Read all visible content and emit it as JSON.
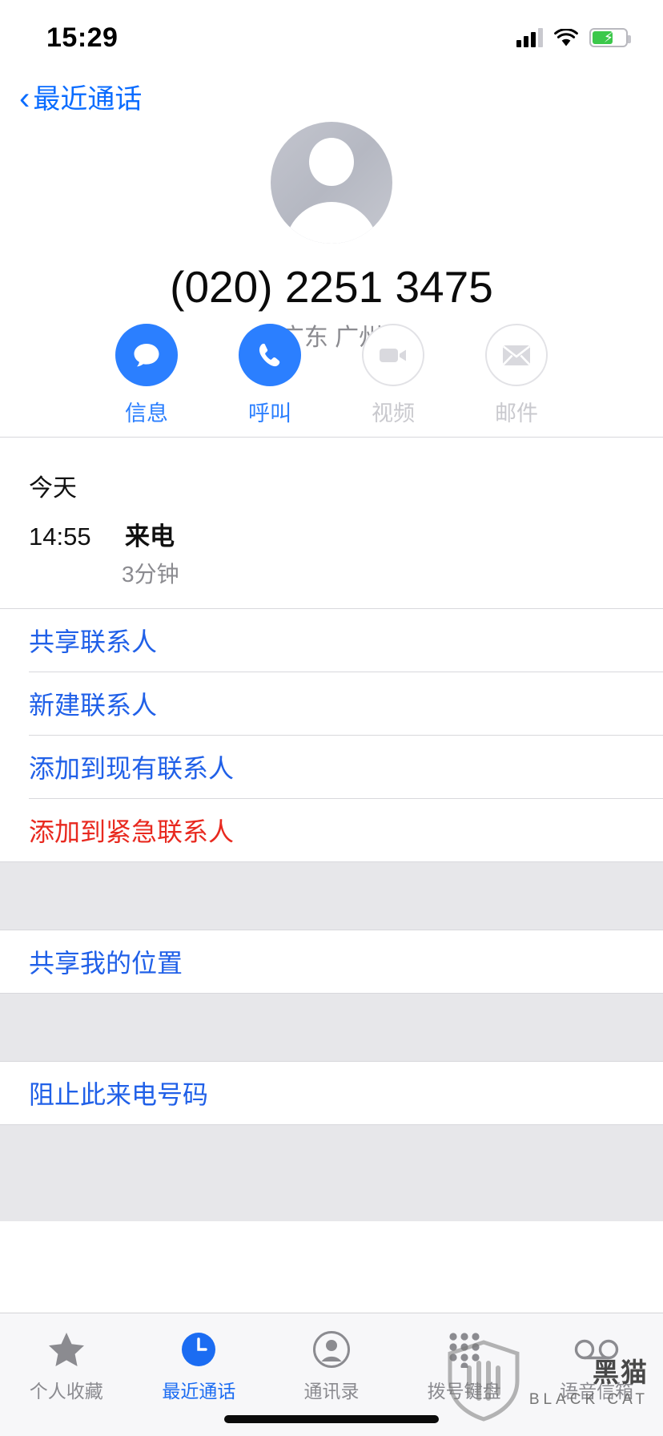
{
  "status_bar": {
    "time": "15:29",
    "signal_icon": "cellular-signal-icon",
    "wifi_icon": "wifi-icon",
    "battery_icon": "battery-charging-icon"
  },
  "nav": {
    "back_label": "最近通话",
    "back_icon": "chevron-left-icon",
    "accent": "#0a6cff"
  },
  "contact": {
    "avatar_icon": "person-placeholder-avatar",
    "phone_number": "(020) 2251 3475",
    "location": "广东 广州"
  },
  "actions": [
    {
      "label": "信息",
      "icon": "message-bubble-icon",
      "enabled": true
    },
    {
      "label": "呼叫",
      "icon": "phone-handset-icon",
      "enabled": true
    },
    {
      "label": "视频",
      "icon": "video-camera-icon",
      "enabled": false
    },
    {
      "label": "邮件",
      "icon": "envelope-icon",
      "enabled": false
    }
  ],
  "call_log": {
    "day_header": "今天",
    "time": "14:55",
    "type": "来电",
    "duration": "3分钟"
  },
  "list": {
    "group1": [
      {
        "label": "共享联系人",
        "style": "blue"
      },
      {
        "label": "新建联系人",
        "style": "blue"
      },
      {
        "label": "添加到现有联系人",
        "style": "blue"
      },
      {
        "label": "添加到紧急联系人",
        "style": "red"
      }
    ],
    "group2": [
      {
        "label": "共享我的位置",
        "style": "blue"
      }
    ],
    "group3": [
      {
        "label": "阻止此来电号码",
        "style": "blue"
      }
    ]
  },
  "tabs": [
    {
      "label": "个人收藏",
      "icon": "star-icon",
      "active": false
    },
    {
      "label": "最近通话",
      "icon": "recents-clock-icon",
      "active": true
    },
    {
      "label": "通讯录",
      "icon": "contacts-person-icon",
      "active": false
    },
    {
      "label": "拨号键盘",
      "icon": "keypad-dots-icon",
      "active": false
    },
    {
      "label": "语音信箱",
      "icon": "voicemail-icon",
      "active": false
    }
  ],
  "watermark": {
    "title": "黑猫",
    "subtitle": "BLACK CAT",
    "shield_icon": "shield-icon"
  },
  "colors": {
    "ios_blue": "#2b7fff",
    "link_blue": "#2060e8",
    "destructive_red": "#e8291f",
    "disabled_grey": "#c9c9ce",
    "group_bg": "#e7e7ea"
  }
}
